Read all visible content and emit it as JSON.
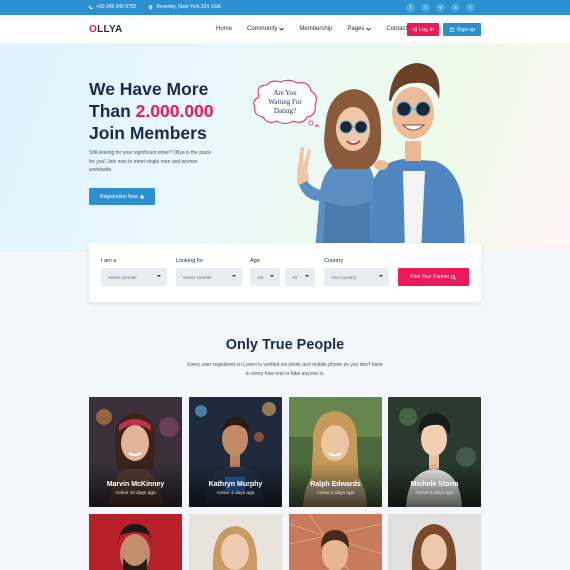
{
  "topbar": {
    "phone": "+00 345 345 6782",
    "address": "Beverley, New York 224 USA",
    "socials": [
      "facebook-icon",
      "twitter-icon",
      "vimeo-icon",
      "skype-icon",
      "rss-icon"
    ]
  },
  "nav": {
    "logo_first": "O",
    "logo_rest": "LLYA",
    "menu": [
      {
        "label": "Home"
      },
      {
        "label": "Community"
      },
      {
        "label": "Membership"
      },
      {
        "label": "Pages"
      },
      {
        "label": "Contact"
      }
    ],
    "login_label": "Log in",
    "signup_label": "Sign up"
  },
  "hero": {
    "title_line1": "We Have More",
    "title_line2_prefix": "Than ",
    "title_highlight": "2.000.000",
    "title_line3": "Join Members",
    "description": "Still looking for your significant other? Ollya is the place for you! Join now to meet single men and women worldwide.",
    "register_label": "Registration Now",
    "bubble_line1": "Are You",
    "bubble_line2": "Waiting For",
    "bubble_line3": "Dating?"
  },
  "search": {
    "iam_label": "I am a",
    "iam_value": "Select Gender",
    "looking_label": "Looking for",
    "looking_value": "Select Gender",
    "age_label": "Age",
    "age_from": "18+",
    "age_to": "48",
    "country_label": "Country",
    "country_value": "Your country",
    "find_label": "Find Your Partner"
  },
  "people": {
    "title": "Only True People",
    "description": "Every user registered on Loven is verified via photo and mobile phone so you don't have to worry how real or fake anyone is.",
    "members": [
      {
        "name": "Marvin McKinney",
        "active": "Active 10 days ago"
      },
      {
        "name": "Kathryn Murphy",
        "active": "Active 3 days ago"
      },
      {
        "name": "Ralph Edwards",
        "active": "Active 2 days ago"
      },
      {
        "name": "Michele Storm",
        "active": "Active 5 days ago"
      }
    ]
  },
  "colors": {
    "brand_pink": "#ed1a5a",
    "brand_blue": "#2c8fd0",
    "navy": "#1b2a4e"
  }
}
